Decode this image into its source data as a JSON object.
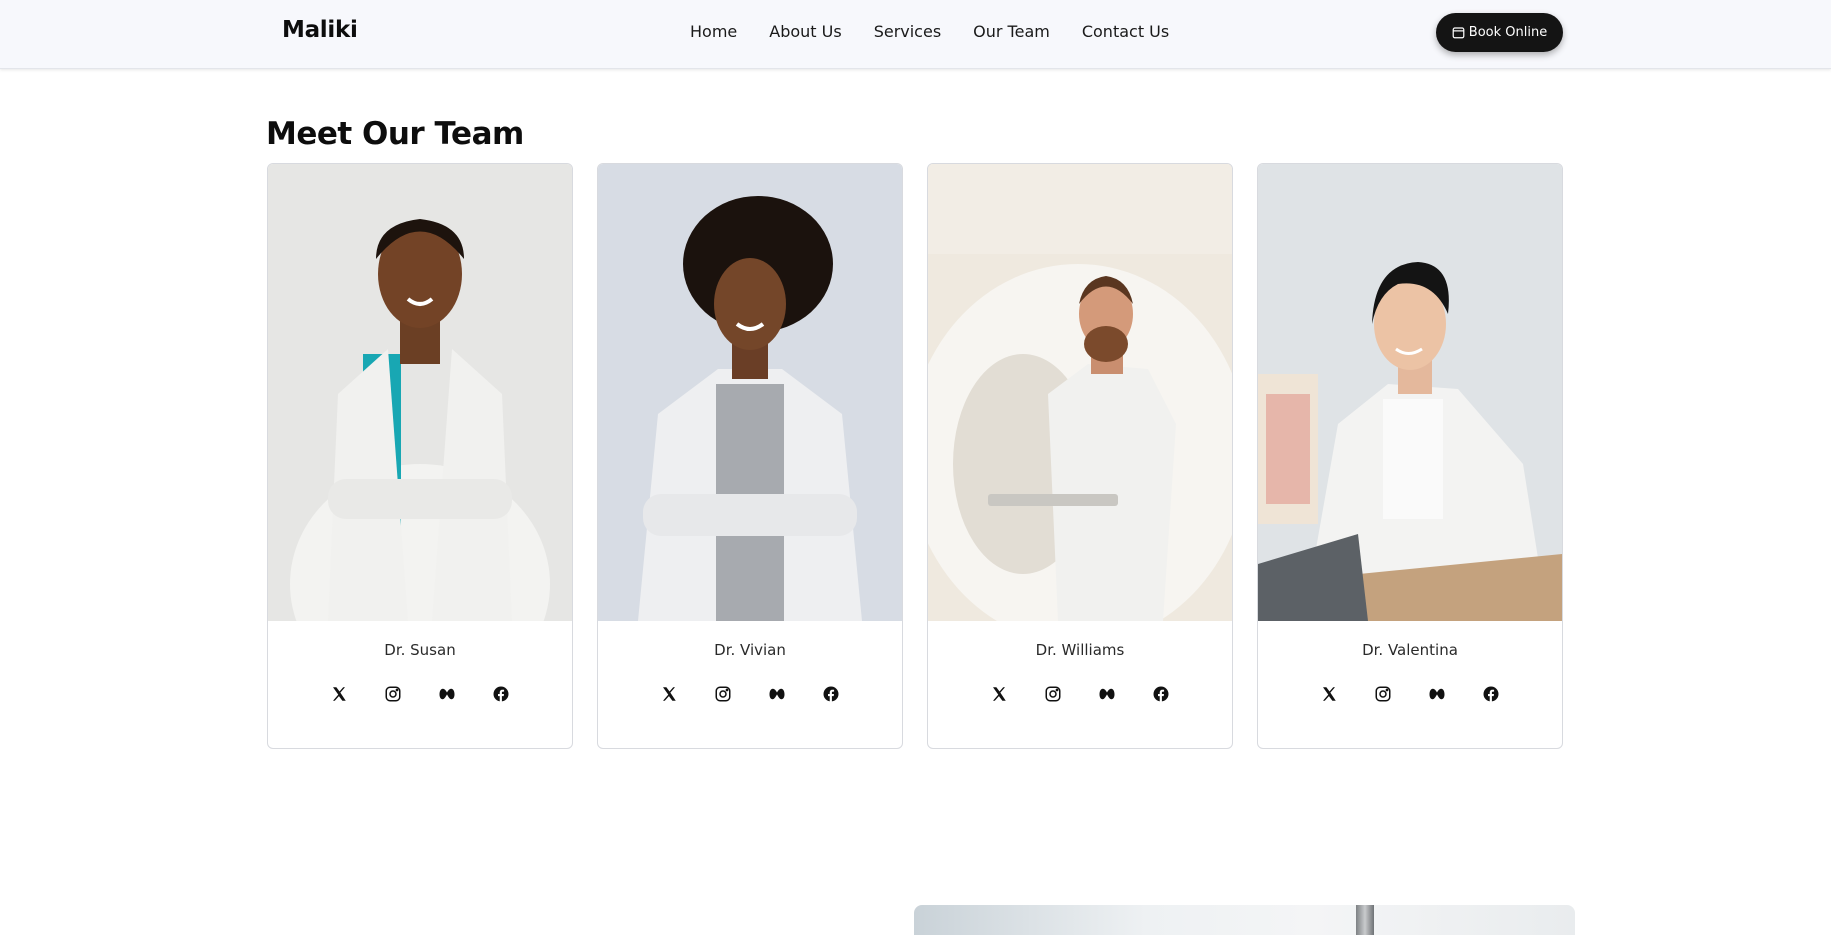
{
  "header": {
    "brand": "Maliki",
    "nav": [
      "Home",
      "About Us",
      "Services",
      "Our Team",
      "Contact Us"
    ],
    "cta_label": "Book Online",
    "cta_icon": "calendar-icon"
  },
  "team": {
    "title": "Meet Our Team",
    "members": [
      {
        "name": "Dr. Susan"
      },
      {
        "name": "Dr. Vivian"
      },
      {
        "name": "Dr. Williams"
      },
      {
        "name": "Dr. Valentina"
      }
    ],
    "social_icons": [
      "x-icon",
      "instagram-icon",
      "threads-icon",
      "facebook-icon"
    ]
  },
  "colors": {
    "nav_bg": "#f7f8fc",
    "cta_bg": "#141414",
    "text": "#111111",
    "card_border": "#d8dadf"
  }
}
